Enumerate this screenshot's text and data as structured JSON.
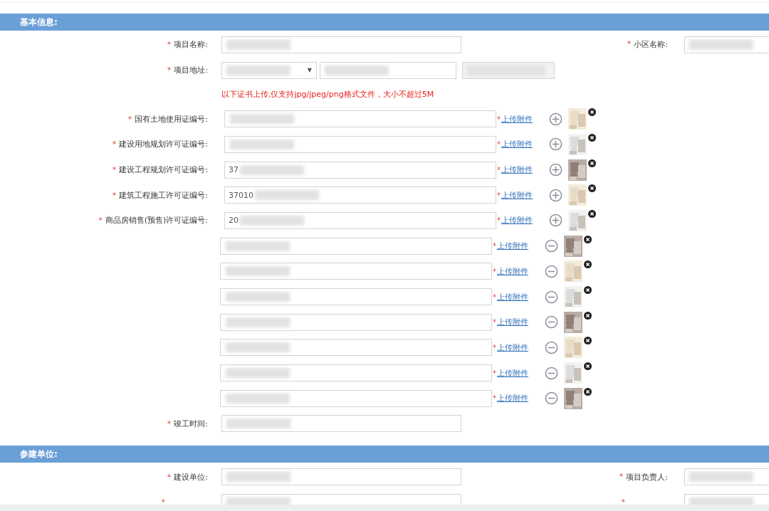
{
  "sections": [
    {
      "title": "基本信息:",
      "rows": [
        {
          "kind": "field",
          "required_mark": "*",
          "label": "项目名称:",
          "right_required_mark": "*",
          "right_label": "小区名称:"
        },
        {
          "kind": "address",
          "required_mark": "*",
          "label": "项目地址:",
          "select_arrow": "▼",
          "coords_disabled": true
        },
        {
          "kind": "notice",
          "text": "以下证书上传,仅支持jpg/jpeg/png格式文件，大小不超过5M"
        },
        {
          "kind": "cert",
          "required_mark": "*",
          "label": "国有土地使用证编号:",
          "link_mark": "*",
          "link": "上传附件",
          "toggle": {
            "kind": "add"
          }
        },
        {
          "kind": "cert",
          "required_mark": "*",
          "label": "建设用地规划许可证编号:",
          "link_mark": "*",
          "link": "上传附件",
          "toggle": {
            "kind": "add"
          }
        },
        {
          "kind": "cert",
          "required_mark": "*",
          "label": "建设工程规划许可证编号:",
          "value": "37",
          "link_mark": "*",
          "link": "上传附件",
          "toggle": {
            "kind": "add"
          }
        },
        {
          "kind": "cert",
          "required_mark": "*",
          "label": "建筑工程施工许可证编号:",
          "value": "37010",
          "link_mark": "*",
          "link": "上传附件",
          "toggle": {
            "kind": "add"
          }
        },
        {
          "kind": "cert",
          "required_mark": "*",
          "label": "商品房销售(预售)许可证编号:",
          "value": "20",
          "link_mark": "*",
          "link": "上传附件",
          "toggle": {
            "kind": "add"
          }
        },
        {
          "kind": "cert",
          "link_mark": "*",
          "link": "上传附件",
          "toggle": {
            "kind": "remove"
          }
        },
        {
          "kind": "cert",
          "link_mark": "*",
          "link": "上传附件",
          "toggle": {
            "kind": "remove"
          }
        },
        {
          "kind": "cert",
          "link_mark": "*",
          "link": "上传附件",
          "toggle": {
            "kind": "remove"
          }
        },
        {
          "kind": "cert",
          "link_mark": "*",
          "link": "上传附件",
          "toggle": {
            "kind": "remove"
          }
        },
        {
          "kind": "cert",
          "link_mark": "*",
          "link": "上传附件",
          "toggle": {
            "kind": "remove"
          }
        },
        {
          "kind": "cert",
          "link_mark": "*",
          "link": "上传附件",
          "toggle": {
            "kind": "remove"
          }
        },
        {
          "kind": "cert",
          "link_mark": "*",
          "link": "上传附件",
          "toggle": {
            "kind": "remove"
          }
        },
        {
          "kind": "field",
          "required_mark": "*",
          "label": "竣工时间:"
        }
      ]
    },
    {
      "title": "参建单位:",
      "rows": [
        {
          "kind": "field",
          "required_mark": "*",
          "label": "建设单位:",
          "right_required_mark": "*",
          "right_label": "项目负责人:"
        },
        {
          "kind": "field",
          "required_mark": "*",
          "right_required_mark": "*"
        }
      ]
    }
  ]
}
